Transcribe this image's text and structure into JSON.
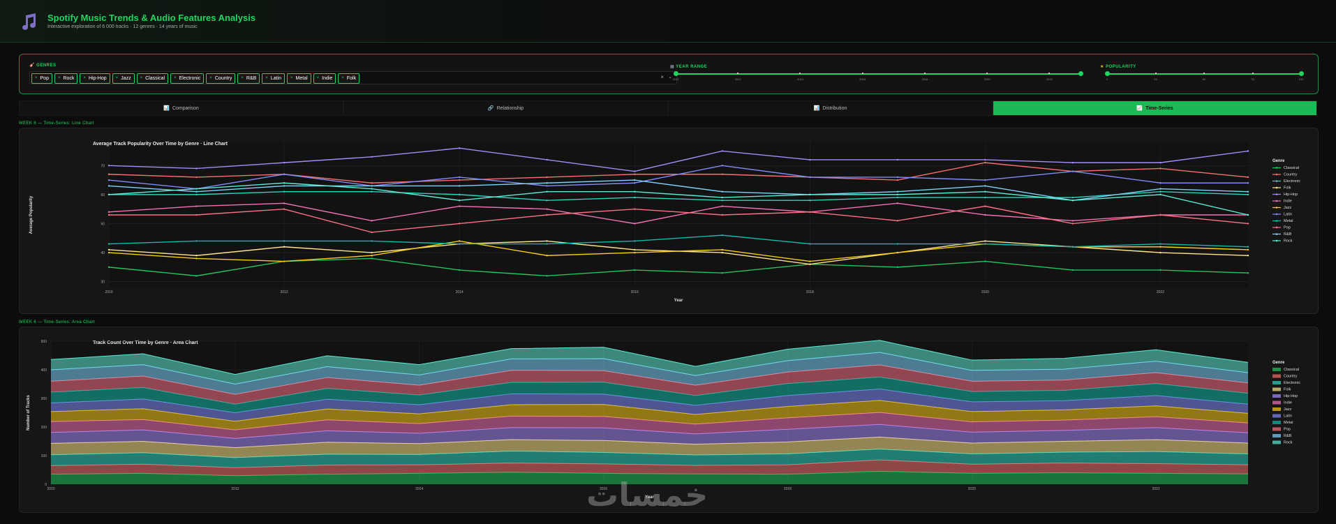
{
  "header": {
    "title": "Spotify Music Trends & Audio Features Analysis",
    "subtitle": "Interactive exploration of 6 000 tracks · 12 genres · 14 years of music"
  },
  "filters": {
    "genres_label": "GENRES",
    "genres": [
      "Pop",
      "Rock",
      "Hip-Hop",
      "Jazz",
      "Classical",
      "Electronic",
      "Country",
      "R&B",
      "Latin",
      "Metal",
      "Indie",
      "Folk"
    ],
    "clear_label": "×",
    "caret_label": "⌄",
    "year_label": "YEAR RANGE",
    "year_ticks": [
      "2010",
      "2012",
      "2014",
      "2016",
      "2018",
      "2020",
      "2022"
    ],
    "year_selected": [
      2010,
      2023
    ],
    "pop_label": "POPULARITY",
    "pop_ticks": [
      "0",
      "25",
      "50",
      "75",
      "100"
    ],
    "pop_selected": [
      0,
      100
    ]
  },
  "tabs": [
    {
      "label": "Comparison",
      "icon": "📊"
    },
    {
      "label": "Relationship",
      "icon": "🔗"
    },
    {
      "label": "Distribution",
      "icon": "📊"
    },
    {
      "label": "Time-Series",
      "icon": "📈"
    }
  ],
  "active_tab": 3,
  "sections": {
    "line_label": "WEEK 6 — Time-Series: Line Chart",
    "area_label": "WEEK 6 — Time-Series: Area Chart"
  },
  "colors": {
    "accent": "#1ed760",
    "Classical": "#22c55e",
    "Country": "#f87171",
    "Electronic": "#2dd4bf",
    "Folk": "#fde68a",
    "Hip-Hop": "#a78bfa",
    "Indie": "#f472b6",
    "Jazz": "#facc15",
    "Latin": "#818cf8",
    "Metal": "#14b8a6",
    "Pop": "#fb7185",
    "R&B": "#7dd3fc",
    "Rock": "#5eead4"
  },
  "chart_data": [
    {
      "type": "line",
      "title": "Average Track Popularity Over Time by Genre · Line Chart",
      "xlabel": "Year",
      "ylabel": "Average Popularity",
      "x": [
        2010,
        2011,
        2012,
        2013,
        2014,
        2015,
        2016,
        2017,
        2018,
        2019,
        2020,
        2021,
        2022,
        2023
      ],
      "xticks": [
        "2010",
        "2012",
        "2014",
        "2016",
        "2018",
        "2020",
        "2022"
      ],
      "yticks": [
        30,
        40,
        50,
        60,
        70
      ],
      "ylim": [
        28,
        78
      ],
      "legend_title": "Genre",
      "series": [
        {
          "name": "Classical",
          "values": [
            35,
            32,
            37,
            38,
            34,
            32,
            34,
            33,
            36,
            35,
            37,
            34,
            34,
            33
          ]
        },
        {
          "name": "Country",
          "values": [
            67,
            66,
            67,
            64,
            65,
            66,
            67,
            67,
            66,
            65,
            71,
            68,
            69,
            66
          ]
        },
        {
          "name": "Electronic",
          "values": [
            60,
            60,
            61,
            61,
            60,
            58,
            59,
            58,
            58,
            59,
            59,
            59,
            61,
            60
          ]
        },
        {
          "name": "Folk",
          "values": [
            41,
            39,
            42,
            40,
            43,
            44,
            41,
            40,
            36,
            40,
            44,
            42,
            40,
            39
          ]
        },
        {
          "name": "Hip-Hop",
          "values": [
            70,
            69,
            71,
            73,
            76,
            72,
            68,
            75,
            72,
            72,
            72,
            71,
            71,
            75
          ]
        },
        {
          "name": "Indie",
          "values": [
            54,
            56,
            57,
            51,
            56,
            55,
            50,
            56,
            54,
            57,
            53,
            51,
            53,
            53
          ]
        },
        {
          "name": "Jazz",
          "values": [
            40,
            38,
            37,
            39,
            44,
            39,
            40,
            41,
            37,
            40,
            43,
            42,
            42,
            41
          ]
        },
        {
          "name": "Latin",
          "values": [
            65,
            62,
            67,
            63,
            66,
            63,
            64,
            70,
            66,
            66,
            65,
            68,
            64,
            64
          ]
        },
        {
          "name": "Metal",
          "values": [
            43,
            44,
            44,
            44,
            43,
            43,
            44,
            46,
            43,
            43,
            43,
            42,
            43,
            42
          ]
        },
        {
          "name": "Pop",
          "values": [
            53,
            53,
            55,
            47,
            50,
            53,
            55,
            53,
            54,
            51,
            56,
            50,
            53,
            50
          ]
        },
        {
          "name": "R&B",
          "values": [
            63,
            61,
            63,
            63,
            63,
            64,
            65,
            61,
            60,
            61,
            63,
            58,
            62,
            61
          ]
        },
        {
          "name": "Rock",
          "values": [
            60,
            62,
            64,
            62,
            58,
            61,
            61,
            59,
            60,
            60,
            61,
            58,
            60,
            53
          ]
        }
      ]
    },
    {
      "type": "area",
      "title": "Track Count Over Time by Genre · Area Chart",
      "xlabel": "Year",
      "ylabel": "Number of Tracks",
      "x": [
        2010,
        2011,
        2012,
        2013,
        2014,
        2015,
        2016,
        2017,
        2018,
        2019,
        2020,
        2021,
        2022,
        2023
      ],
      "xticks": [
        "2010",
        "2012",
        "2014",
        "2016",
        "2018",
        "2020",
        "2022"
      ],
      "yticks": [
        0,
        100,
        200,
        300,
        400,
        500
      ],
      "ylim": [
        0,
        500
      ],
      "legend_title": "Genre",
      "stacked": true,
      "series": [
        {
          "name": "Classical",
          "values": [
            35,
            38,
            30,
            35,
            38,
            42,
            38,
            36,
            35,
            45,
            38,
            40,
            38,
            36
          ]
        },
        {
          "name": "Country",
          "values": [
            30,
            32,
            28,
            32,
            30,
            32,
            33,
            30,
            33,
            40,
            32,
            34,
            34,
            32
          ]
        },
        {
          "name": "Electronic",
          "values": [
            38,
            40,
            35,
            38,
            36,
            42,
            40,
            36,
            38,
            38,
            36,
            38,
            42,
            38
          ]
        },
        {
          "name": "Folk",
          "values": [
            40,
            40,
            35,
            42,
            38,
            40,
            42,
            38,
            42,
            42,
            38,
            38,
            42,
            38
          ]
        },
        {
          "name": "Hip-Hop",
          "values": [
            38,
            40,
            32,
            40,
            36,
            42,
            44,
            36,
            44,
            44,
            38,
            38,
            42,
            36
          ]
        },
        {
          "name": "Indie",
          "values": [
            38,
            36,
            30,
            38,
            34,
            40,
            40,
            34,
            40,
            42,
            36,
            36,
            38,
            34
          ]
        },
        {
          "name": "Jazz",
          "values": [
            35,
            38,
            30,
            38,
            34,
            40,
            42,
            34,
            40,
            42,
            36,
            36,
            38,
            34
          ]
        },
        {
          "name": "Latin",
          "values": [
            30,
            34,
            30,
            34,
            32,
            38,
            36,
            32,
            38,
            40,
            34,
            32,
            36,
            32
          ]
        },
        {
          "name": "Metal",
          "values": [
            38,
            40,
            30,
            38,
            34,
            40,
            42,
            34,
            42,
            42,
            36,
            36,
            42,
            38
          ]
        },
        {
          "name": "Pop",
          "values": [
            38,
            40,
            34,
            38,
            34,
            42,
            40,
            36,
            40,
            42,
            36,
            36,
            38,
            36
          ]
        },
        {
          "name": "R&B",
          "values": [
            40,
            40,
            36,
            38,
            36,
            40,
            42,
            34,
            40,
            44,
            38,
            38,
            40,
            36
          ]
        },
        {
          "name": "Rock",
          "values": [
            36,
            38,
            34,
            38,
            36,
            36,
            40,
            32,
            40,
            42,
            36,
            38,
            40,
            36
          ]
        }
      ]
    }
  ],
  "watermark": "خمسات"
}
